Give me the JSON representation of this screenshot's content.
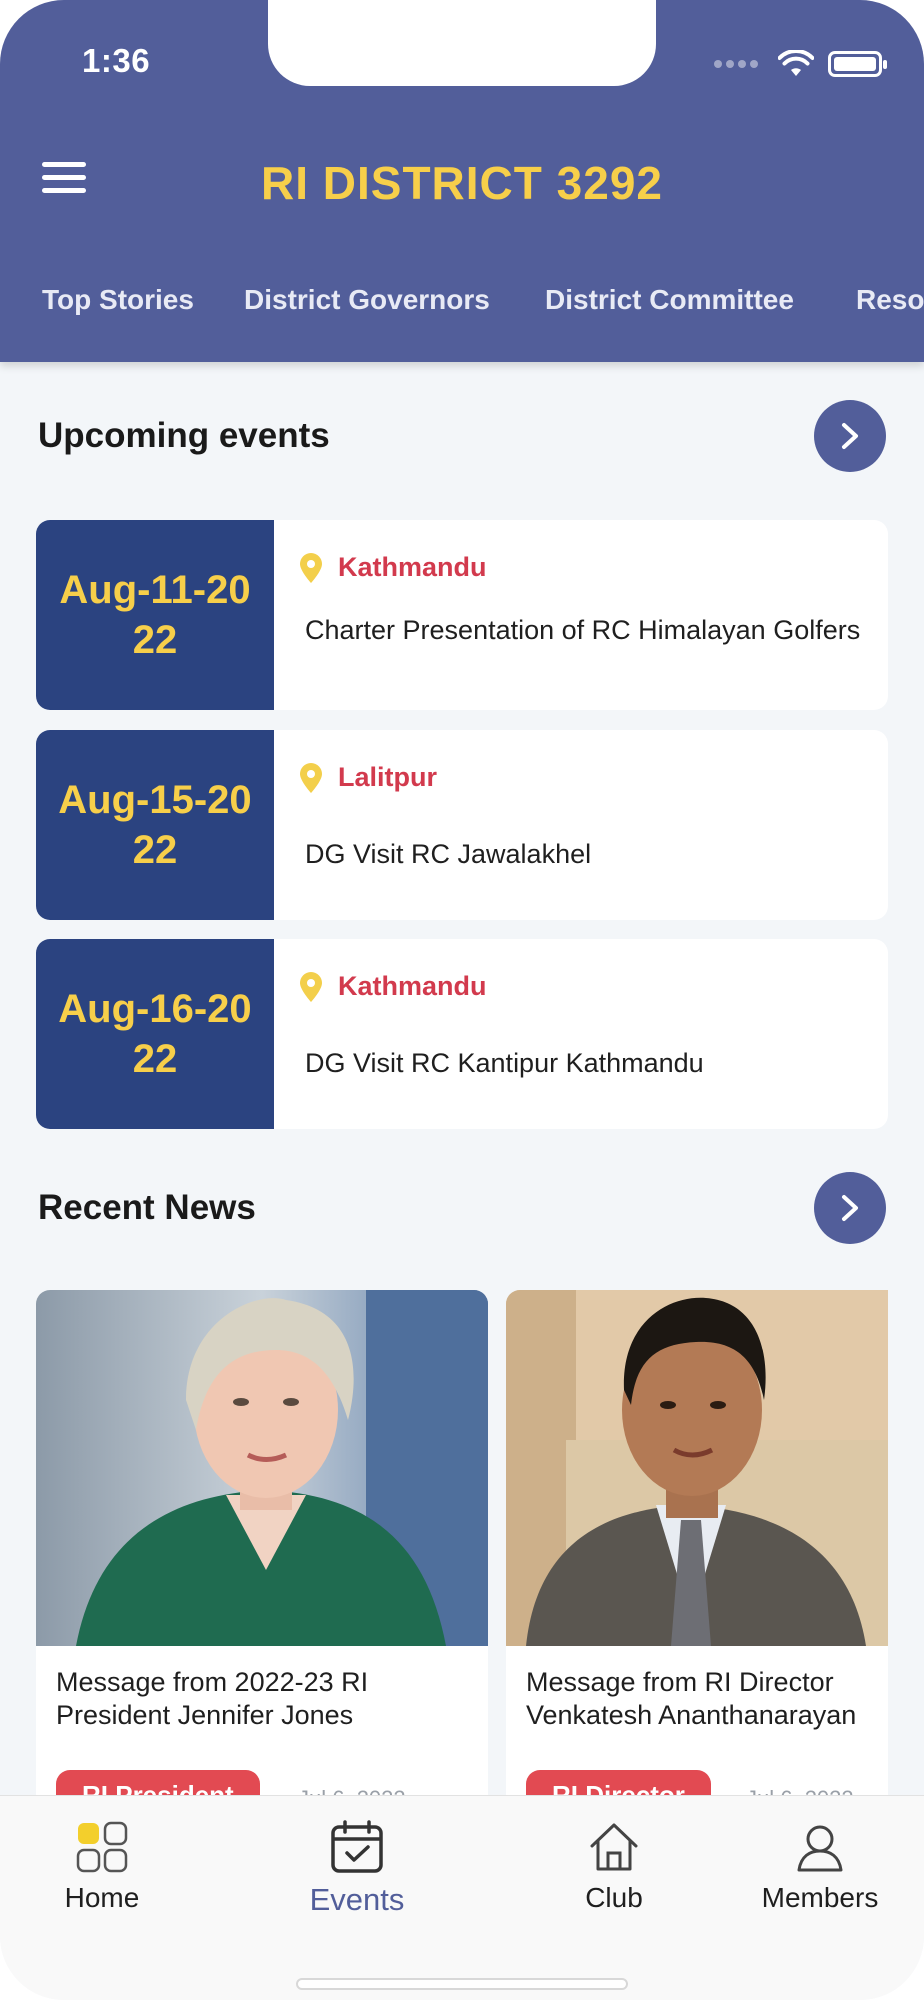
{
  "status_bar": {
    "time": "1:36"
  },
  "header": {
    "title": "RI DISTRICT 3292"
  },
  "tabs": [
    {
      "label": "Top Stories"
    },
    {
      "label": "District Governors"
    },
    {
      "label": "District Committee"
    },
    {
      "label": "Reso"
    }
  ],
  "upcoming": {
    "title": "Upcoming events",
    "events": [
      {
        "date": "Aug-11-2022",
        "location": "Kathmandu",
        "title": "Charter Presentation of RC Himalayan Golfers"
      },
      {
        "date": "Aug-15-2022",
        "location": "Lalitpur",
        "title": "DG Visit RC Jawalakhel"
      },
      {
        "date": "Aug-16-2022",
        "location": "Kathmandu",
        "title": "DG Visit RC Kantipur Kathmandu"
      }
    ]
  },
  "news": {
    "title": "Recent News",
    "items": [
      {
        "title": "Message from 2022-23 RI President Jennifer Jones",
        "badge": "RI President",
        "date": "Jul 6, 2022"
      },
      {
        "title": "Message from RI Director Venkatesh Ananthanarayan",
        "badge": "RI Director",
        "date": "Jul 6, 2022"
      }
    ]
  },
  "tabbar": {
    "items": [
      {
        "label": "Home",
        "icon": "home-grid-icon"
      },
      {
        "label": "Events",
        "icon": "calendar-check-icon"
      },
      {
        "label": "Club",
        "icon": "house-icon"
      },
      {
        "label": "Members",
        "icon": "person-icon"
      }
    ],
    "active_index": 1
  },
  "colors": {
    "header": "#525e9a",
    "accent": "#f7cf4a",
    "date_block": "#2b4380",
    "location": "#d23a4d",
    "badge": "#e24a52"
  }
}
